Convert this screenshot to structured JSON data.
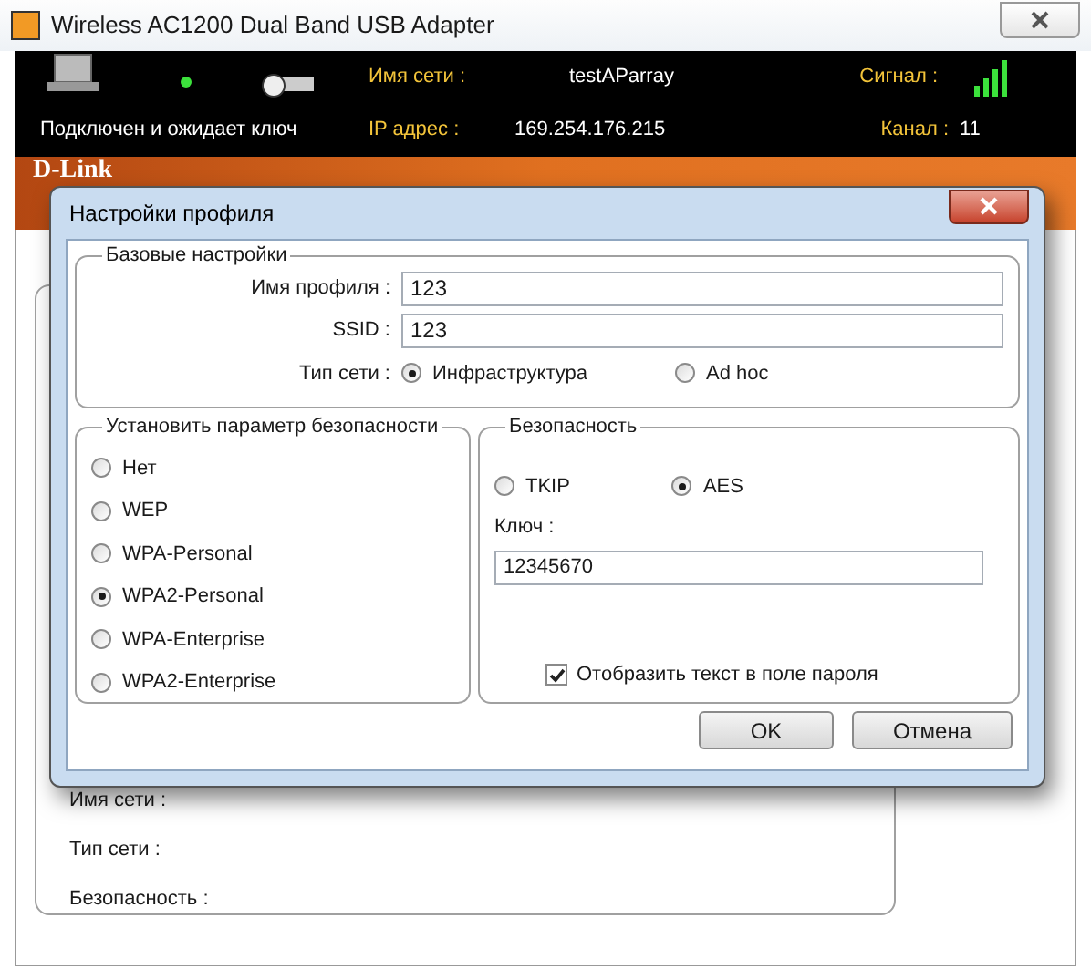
{
  "window": {
    "title": "Wireless AC1200 Dual Band USB Adapter"
  },
  "header": {
    "status": "Подключен и ожидает ключ",
    "network_name_label": "Имя сети :",
    "network_name": "testAParray",
    "ip_label": "IP адрес :",
    "ip": "169.254.176.215",
    "signal_label": "Сигнал :",
    "channel_label": "Канал :",
    "channel": "11"
  },
  "brand": "D-Link",
  "background_panel": {
    "fields": [
      "Имя сети :",
      "Тип сети :",
      "Безопасность :"
    ]
  },
  "dialog": {
    "title": "Настройки профиля",
    "basic": {
      "title": "Базовые настройки",
      "fields": [
        {
          "label": "Имя профиля :",
          "value": "123"
        },
        {
          "label": "SSID :",
          "value": "123"
        }
      ],
      "network_type": {
        "label": "Тип сети :",
        "options": [
          {
            "label": "Инфраструктура",
            "selected": true
          },
          {
            "label": "Ad hoc",
            "selected": false
          }
        ]
      }
    },
    "security_mode": {
      "title": "Установить параметр безопасности",
      "options": [
        {
          "label": "Нет",
          "selected": false
        },
        {
          "label": "WEP",
          "selected": false
        },
        {
          "label": "WPA-Personal",
          "selected": false
        },
        {
          "label": "WPA2-Personal",
          "selected": true
        },
        {
          "label": "WPA-Enterprise",
          "selected": false
        },
        {
          "label": "WPA2-Enterprise",
          "selected": false
        }
      ]
    },
    "security": {
      "title": "Безопасность",
      "ciphers": [
        {
          "label": "TKIP",
          "selected": false
        },
        {
          "label": "AES",
          "selected": true
        }
      ],
      "key_label": "Ключ :",
      "key": "12345670",
      "show_password": {
        "label": "Отобразить текст в поле пароля",
        "checked": true
      }
    },
    "buttons": [
      "OK",
      "Отмена"
    ]
  }
}
